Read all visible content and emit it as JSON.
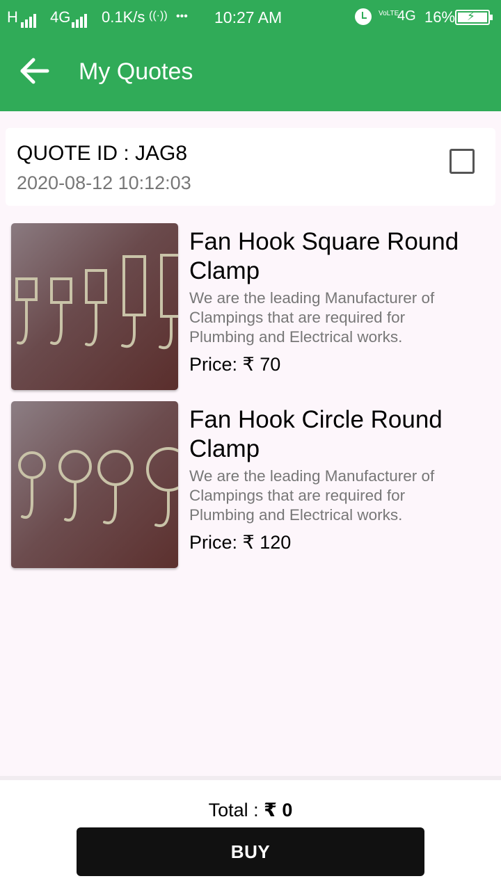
{
  "status_bar": {
    "net1": "H",
    "net2": "4G",
    "speed": "0.1K/s",
    "hotspot": "((·))",
    "dots": "•••",
    "time": "10:27 AM",
    "volte": "VoLTE",
    "net3": "4G",
    "battery_percent": "16%",
    "battery_level": 0.16
  },
  "app_bar": {
    "title": "My Quotes",
    "back_icon": "arrow-left-icon"
  },
  "quote": {
    "id_label": "QUOTE ID : JAG8",
    "date": "2020-08-12 10:12:03",
    "checked": false
  },
  "products": [
    {
      "name": "Fan Hook Square Round Clamp",
      "description": "We are the leading Manufacturer of Clampings that are required for Plumbing and Electrical works.",
      "price": "Price: ₹ 70"
    },
    {
      "name": "Fan Hook Circle Round Clamp",
      "description": "We are the leading Manufacturer of Clampings that are required for Plumbing and Electrical works.",
      "price": "Price: ₹ 120"
    }
  ],
  "footer": {
    "total_label": "Total :",
    "total_value": "₹ 0",
    "buy_label": "BUY"
  }
}
